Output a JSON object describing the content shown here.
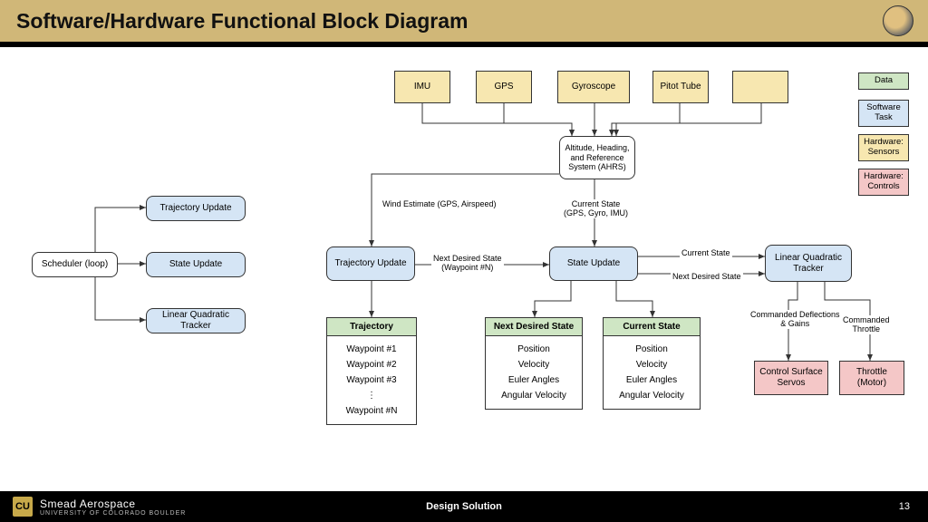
{
  "title": "Software/Hardware Functional Block Diagram",
  "footer": {
    "brand_main": "Smead Aerospace",
    "brand_sub": "UNIVERSITY OF COLORADO BOULDER",
    "center": "Design Solution",
    "page": "13",
    "cu": "CU"
  },
  "sensors": {
    "imu": "IMU",
    "gps": "GPS",
    "gyro": "Gyroscope",
    "pitot": "Pitot Tube"
  },
  "ahrs": "Altitude, Heading, and Reference System (AHRS)",
  "scheduler": {
    "loop": "Scheduler (loop)",
    "traj": "Trajectory Update",
    "state": "State Update",
    "lqt": "Linear Quadratic Tracker"
  },
  "main": {
    "traj_update": "Trajectory Update",
    "state_update": "State Update",
    "lqt": "Linear Quadratic Tracker"
  },
  "edges": {
    "wind": "Wind Estimate (GPS, Airspeed)",
    "cur_state": "Current State\n(GPS, Gyro, IMU)",
    "next_wp": "Next Desired State\n(Waypoint #N)",
    "cur_state2": "Current State",
    "next_desired": "Next Desired State",
    "cmd_defl": "Commanded Deflections\n& Gains",
    "cmd_throttle": "Commanded\nThrottle"
  },
  "tables": {
    "trajectory": {
      "title": "Trajectory",
      "rows": [
        "Waypoint #1",
        "Waypoint #2",
        "Waypoint #3",
        "⋮",
        "Waypoint #N"
      ]
    },
    "next_desired": {
      "title": "Next Desired State",
      "rows": [
        "Position",
        "Velocity",
        "Euler Angles",
        "Angular Velocity"
      ]
    },
    "current_state": {
      "title": "Current State",
      "rows": [
        "Position",
        "Velocity",
        "Euler Angles",
        "Angular Velocity"
      ]
    }
  },
  "controls": {
    "servos": "Control Surface Servos",
    "throttle": "Throttle\n(Motor)"
  },
  "legend": {
    "data": "Data",
    "soft": "Software Task",
    "sensors": "Hardware: Sensors",
    "controls": "Hardware: Controls"
  }
}
